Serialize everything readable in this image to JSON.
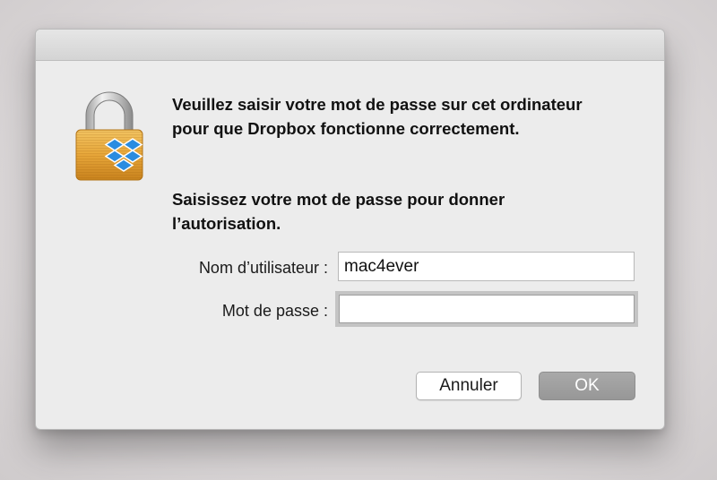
{
  "dialog": {
    "message": "Veuillez saisir votre mot de passe sur cet ordinateur pour que Dropbox fonctionne correctement.",
    "instruction": "Saisissez votre mot de passe pour donner l’autorisation.",
    "icon": "lock-dropbox-icon"
  },
  "form": {
    "username_label": "Nom d’utilisateur :",
    "username_value": "mac4ever",
    "password_label": "Mot de passe :",
    "password_value": ""
  },
  "buttons": {
    "cancel_label": "Annuler",
    "ok_label": "OK"
  },
  "colors": {
    "lock_body": "#e8a73a",
    "lock_shackle": "#c9c9c9",
    "dropbox_blue": "#2a8ce0",
    "ok_button": "#a1a1a1"
  }
}
